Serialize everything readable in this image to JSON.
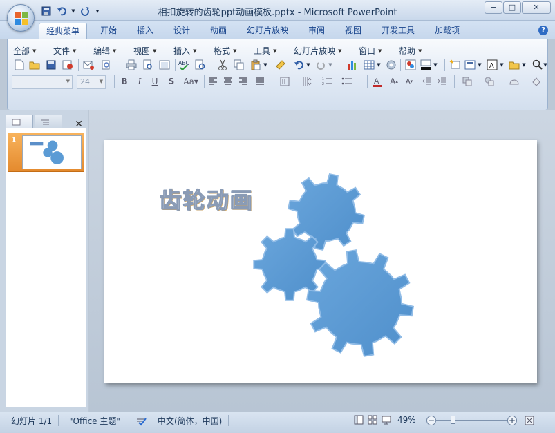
{
  "window": {
    "title": "相扣旋转的齿轮ppt动画模板.pptx - Microsoft PowerPoint",
    "controls": [
      "−",
      "□",
      "✕"
    ]
  },
  "ribbon_tabs": [
    {
      "label": "经典菜单",
      "active": true
    },
    {
      "label": "开始"
    },
    {
      "label": "插入"
    },
    {
      "label": "设计"
    },
    {
      "label": "动画"
    },
    {
      "label": "幻灯片放映"
    },
    {
      "label": "审阅"
    },
    {
      "label": "视图"
    },
    {
      "label": "开发工具"
    },
    {
      "label": "加载项"
    }
  ],
  "classic_menu": [
    "全部",
    "文件",
    "编辑",
    "视图",
    "插入",
    "格式",
    "工具",
    "幻灯片放映",
    "窗口",
    "帮助"
  ],
  "font": {
    "name_value": "",
    "size_value": "24"
  },
  "slide": {
    "number": "1",
    "title_text": "齿轮动画"
  },
  "status": {
    "slide_info": "幻灯片 1/1",
    "theme": "\"Office 主题\"",
    "language": "中文(简体，中国)",
    "zoom": "49%"
  },
  "colors": {
    "gear_fill": "#5b9bd5",
    "gear_edge": "#8fbbe6",
    "thumb_selected": "#e8963a"
  }
}
